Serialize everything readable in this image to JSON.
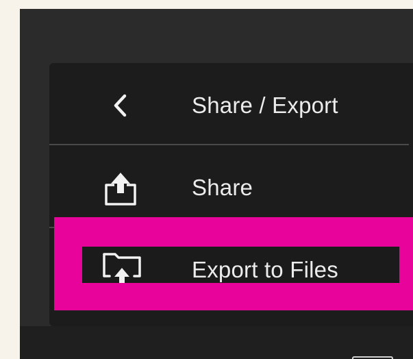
{
  "menu": {
    "header": {
      "back_icon": "chevron-left-icon",
      "title": "Share / Export"
    },
    "items": [
      {
        "label": "Share",
        "icon": "share-upload-icon"
      },
      {
        "label": "Export to Files",
        "icon": "folder-export-icon"
      }
    ]
  },
  "colors": {
    "highlight": "#e8039b",
    "panel": "#1c1c1c",
    "window": "#2b2b2b",
    "text": "#ececec"
  }
}
